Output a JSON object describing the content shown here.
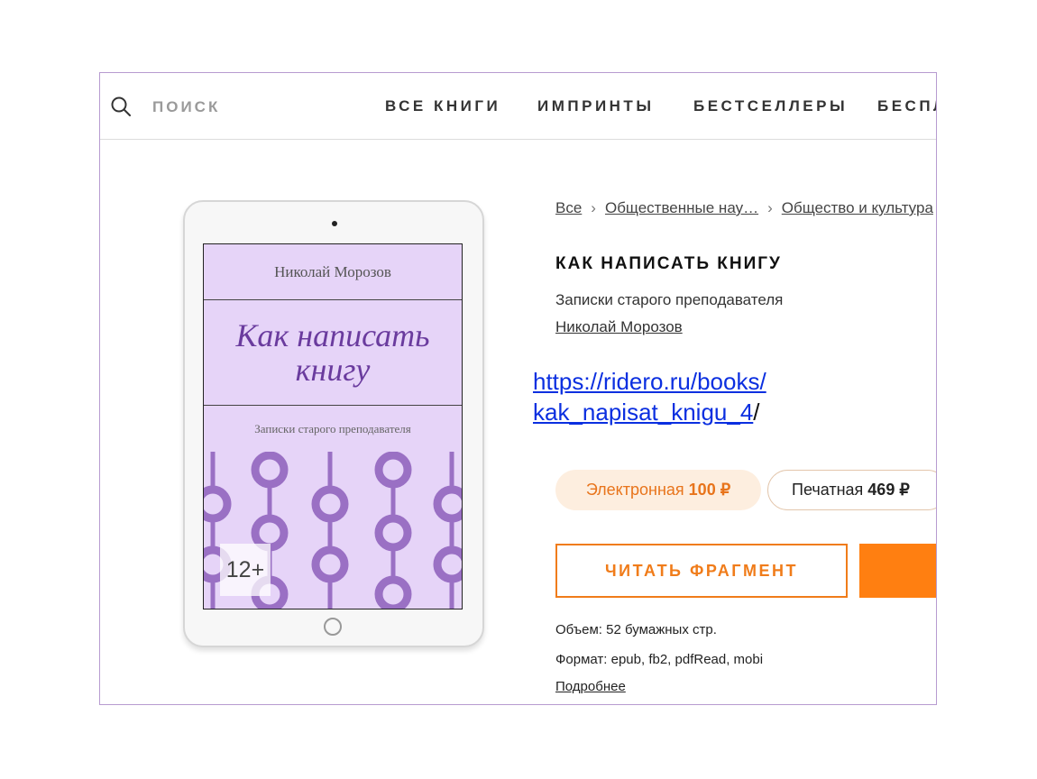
{
  "search": {
    "label": "ПОИСК"
  },
  "nav": {
    "items": [
      {
        "label": "ВСЕ КНИГИ"
      },
      {
        "label": "ИМПРИНТЫ"
      },
      {
        "label": "БЕСТСЕЛЛЕРЫ"
      },
      {
        "label": "БЕСПЛ"
      }
    ]
  },
  "breadcrumb": {
    "items": [
      {
        "label": "Все"
      },
      {
        "label": "Общественные нау…"
      },
      {
        "label": "Общество и культура"
      }
    ],
    "separator": "›"
  },
  "cover": {
    "author": "Николай Морозов",
    "title_line1": "Как написать",
    "title_line2": "книгу",
    "subtitle": "Записки старого преподавателя",
    "age_rating": "12+"
  },
  "book": {
    "title": "КАК НАПИСАТЬ КНИГУ",
    "subtitle": "Записки старого преподавателя",
    "author": "Николай Морозов",
    "url_line1": "https://ridero.ru/books/",
    "url_line2": "kak_napisat_knigu_4",
    "url_trailing": "/"
  },
  "prices": {
    "electronic_label": "Электронная",
    "electronic_value": "100 ₽",
    "print_label": "Печатная",
    "print_value": "469 ₽"
  },
  "actions": {
    "read_fragment": "ЧИТАТЬ ФРАГМЕНТ"
  },
  "details": {
    "volume": "Объем: 52 бумажных стр.",
    "format": "Формат: epub, fb2, pdfRead, mobi",
    "more": "Подробнее"
  },
  "colors": {
    "accent_orange": "#f07c1a",
    "cover_lilac": "#e6d4f8",
    "cover_title": "#6a3b9e",
    "link_blue": "#0b2fe0"
  }
}
